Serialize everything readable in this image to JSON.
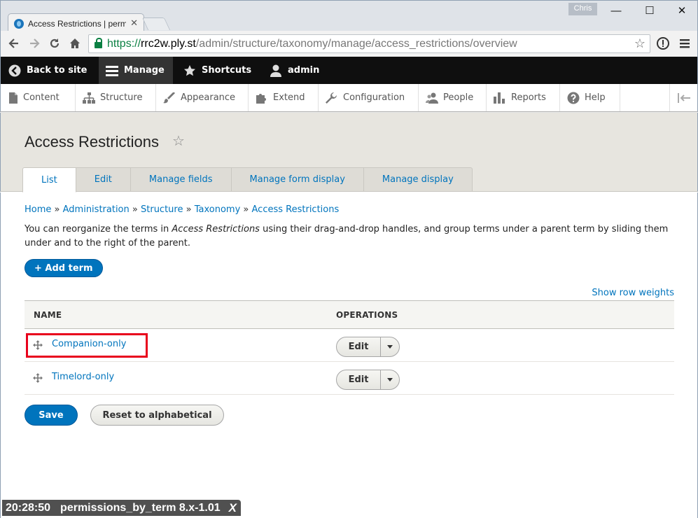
{
  "browser": {
    "tab_title": "Access Restrictions | perm",
    "tab_close": "✕",
    "user_name": "Chris",
    "window": {
      "minimize": "—",
      "maximize": "☐",
      "close": "✕"
    },
    "url_scheme": "https://",
    "url_host": "rrc2w.ply.st",
    "url_path": "/admin/structure/taxonomy/manage/access_restrictions/overview"
  },
  "drupal_toolbar": {
    "back_to_site": "Back to site",
    "manage": "Manage",
    "shortcuts": "Shortcuts",
    "user": "admin"
  },
  "admin_menu": {
    "items": [
      {
        "label": "Content"
      },
      {
        "label": "Structure"
      },
      {
        "label": "Appearance"
      },
      {
        "label": "Extend"
      },
      {
        "label": "Configuration"
      },
      {
        "label": "People"
      },
      {
        "label": "Reports"
      },
      {
        "label": "Help"
      }
    ]
  },
  "page": {
    "title": "Access Restrictions",
    "tabs": [
      {
        "label": "List",
        "active": true
      },
      {
        "label": "Edit"
      },
      {
        "label": "Manage fields"
      },
      {
        "label": "Manage form display"
      },
      {
        "label": "Manage display"
      }
    ]
  },
  "breadcrumb": {
    "items": [
      "Home",
      "Administration",
      "Structure",
      "Taxonomy",
      "Access Restrictions"
    ],
    "separator": "»"
  },
  "description": {
    "before": "You can reorganize the terms in ",
    "vocab": "Access Restrictions",
    "after": " using their drag-and-drop handles, and group terms under a parent term by sliding them under and to the right of the parent."
  },
  "actions": {
    "add_term": "+ Add term",
    "show_row_weights": "Show row weights",
    "save": "Save",
    "reset": "Reset to alphabetical"
  },
  "table": {
    "headers": {
      "name": "NAME",
      "operations": "OPERATIONS"
    },
    "rows": [
      {
        "name": "Companion-only",
        "op": "Edit",
        "highlighted": true
      },
      {
        "name": "Timelord-only",
        "op": "Edit",
        "highlighted": false
      }
    ]
  },
  "overlay": {
    "time": "20:28:50",
    "label": "permissions_by_term 8.x-1.01",
    "close": "X"
  },
  "colors": {
    "link": "#0074bd",
    "primary_button": "#0074bd",
    "highlight_border": "#e8001c",
    "header_bg": "#e7e5df",
    "drupal_bar": "#0f0f0f"
  }
}
